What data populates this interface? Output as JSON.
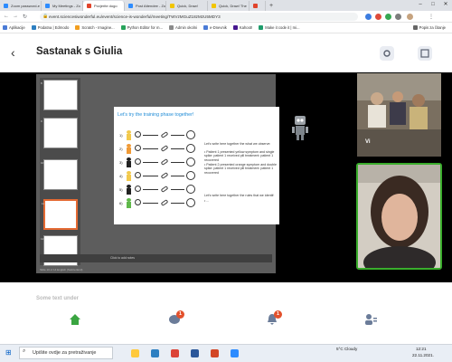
{
  "browser": {
    "tabs": [
      {
        "label": "Zoom password-e",
        "color": "#2d8cff"
      },
      {
        "label": "My Meetings - Zo",
        "color": "#2d8cff"
      },
      {
        "label": "Povjerite dogo",
        "color": "#e1442b"
      },
      {
        "label": "Post Attendee - Zo",
        "color": "#2d8cff"
      },
      {
        "label": "Quick, Draw!",
        "color": "#f2c500"
      },
      {
        "label": "Quick, Draw! The",
        "color": "#f2c500"
      },
      {
        "label": "",
        "color": "#e1442b"
      }
    ],
    "new_tab": "+",
    "url": "event.sciencesiwonderful.eu/event/science-is-wonderful/meeting/TWVzMGuZ18zMzU5MDY3",
    "bookmarks": [
      {
        "label": "Aplikacije",
        "color": "#4a7bd6"
      },
      {
        "label": "Podatna | Edmodo",
        "color": "#2d7fc1"
      },
      {
        "label": "Scratch - Imagine...",
        "color": "#f29e1f"
      },
      {
        "label": "Python Editor for m...",
        "color": "#27a35a"
      },
      {
        "label": "Admin okolni",
        "color": "#8a8a8a"
      },
      {
        "label": "e-Dnevnik",
        "color": "#4a7bd6"
      },
      {
        "label": "Kahoot!",
        "color": "#46178f"
      },
      {
        "label": "Make it code it | mi...",
        "color": "#1e9c6b"
      },
      {
        "label": "Popis za čitanje",
        "color": "#666"
      }
    ]
  },
  "header": {
    "back": "‹",
    "title": "Sastanak s Giulia"
  },
  "slide": {
    "title": "Let's try the training phase together!",
    "row_nums": [
      "1)",
      "2)",
      "3)",
      "4)",
      "5)",
      "6)"
    ],
    "observe_intro": "Let's write here together the what we observe:",
    "observations": [
      "Patient 1 presented yellow symptom and single spike: patient 1 received pill treatment: patient 1 recovered",
      "Patient 2 presented orange symptom and double spike: patient 1 received pill treatment: patient 1 recovered"
    ],
    "rules_intro": "Let's write here together the rules that we identif:",
    "rules_bullet": "..."
  },
  "notes_label": "Click to add notes",
  "status_bar": "Slide 10 of 14     English (Switzerland)",
  "thumb_numbers": [
    "8",
    "9",
    "10",
    "11",
    "12"
  ],
  "participant_label": "Vi",
  "peek_text": "Some text under",
  "nav": {
    "chat_badge": "1",
    "notif_badge": "1"
  },
  "taskbar": {
    "search_placeholder": "Upišite ovdje za pretraživanje",
    "weather": "5°C  Cloudy",
    "time": "12:21",
    "date": "22.11.2021."
  },
  "colors": {
    "participant_border": "#3aad2c",
    "badge": "#e3512c",
    "slide_title": "#1e8bd6",
    "selected_thumb": "#e46a33"
  }
}
